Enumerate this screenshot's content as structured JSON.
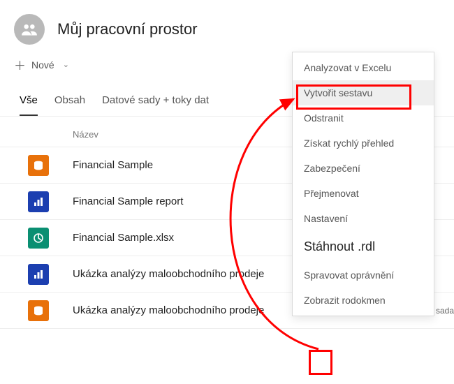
{
  "workspace": {
    "title": "Můj pracovní prostor"
  },
  "toolbar": {
    "new_label": "Nové"
  },
  "tabs": {
    "all": "Vše",
    "content": "Obsah",
    "datasets": "Datové sady + toky dat"
  },
  "columns": {
    "name": "Název"
  },
  "rows": [
    {
      "name": "Financial Sample",
      "icon": "dataset"
    },
    {
      "name": "Financial Sample report",
      "icon": "report"
    },
    {
      "name": "Financial Sample.xlsx",
      "icon": "workbook"
    },
    {
      "name": "Ukázka analýzy maloobchodního prodeje",
      "icon": "report"
    },
    {
      "name": "Ukázka analýzy maloobchodního prodeje",
      "icon": "dataset",
      "type_label": "Datová sada",
      "show_actions": true
    }
  ],
  "context_menu": {
    "analyze_excel": "Analyzovat v Excelu",
    "create_report": "Vytvořit sestavu",
    "delete": "Odstranit",
    "quick_insights": "Získat rychlý přehled",
    "security": "Zabezpečení",
    "rename": "Přejmenovat",
    "settings": "Nastavení",
    "download_rdl": "Stáhnout .rdl",
    "manage_perms": "Spravovat oprávnění",
    "view_lineage": "Zobrazit rodokmen"
  }
}
